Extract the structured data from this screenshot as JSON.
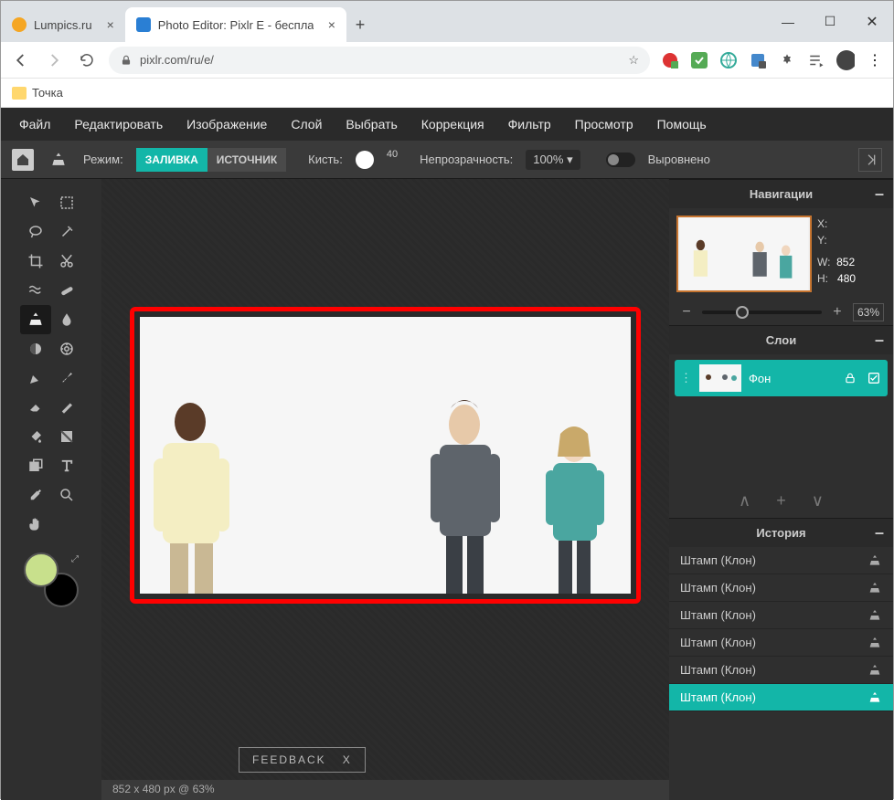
{
  "browser": {
    "tabs": [
      {
        "title": "Lumpics.ru"
      },
      {
        "title": "Photo Editor: Pixlr E - бесплатны"
      }
    ],
    "url": "pixlr.com/ru/e/",
    "bookmark": "Точка"
  },
  "menubar": {
    "file": "Файл",
    "edit": "Редактировать",
    "image": "Изображение",
    "layer": "Слой",
    "select": "Выбрать",
    "adjust": "Коррекция",
    "filter": "Фильтр",
    "view": "Просмотр",
    "help": "Помощь"
  },
  "toolbar": {
    "mode_label": "Режим:",
    "mode_fill": "ЗАЛИВКА",
    "mode_source": "ИСТОЧНИК",
    "brush_label": "Кисть:",
    "brush_size": "40",
    "opacity_label": "Непрозрачность:",
    "opacity_value": "100% ▾",
    "aligned_label": "Выровнено"
  },
  "panels": {
    "nav_title": "Навигации",
    "layers_title": "Слои",
    "history_title": "История",
    "coord_x": "X:",
    "coord_y": "Y:",
    "dim_w_label": "W:",
    "dim_w": "852",
    "dim_h_label": "H:",
    "dim_h": "480",
    "zoom": "63%",
    "layer_name": "Фон",
    "history_items": [
      "Штамп (Клон)",
      "Штамп (Клон)",
      "Штамп (Клон)",
      "Штамп (Клон)",
      "Штамп (Клон)",
      "Штамп (Клон)"
    ]
  },
  "statusbar": "852 x 480 px @ 63%",
  "feedback": {
    "label": "FEEDBACK",
    "close": "X"
  }
}
